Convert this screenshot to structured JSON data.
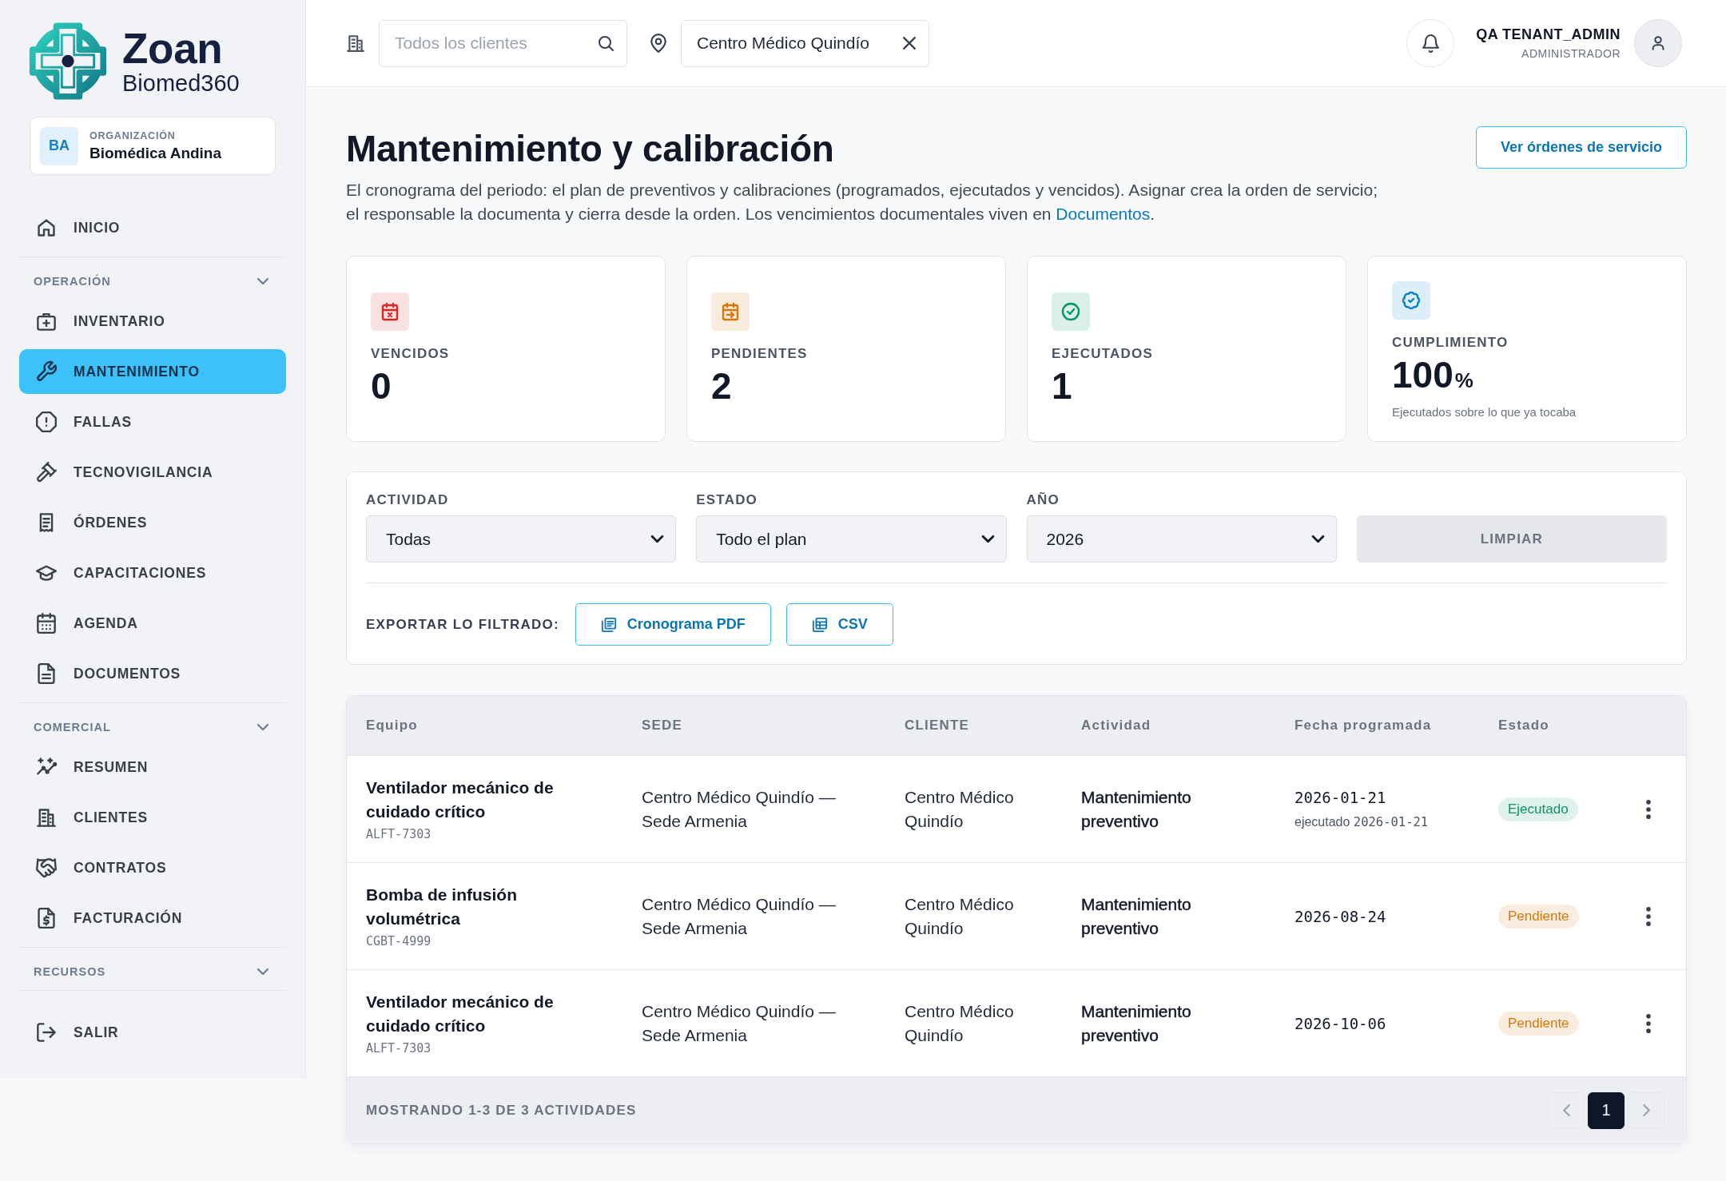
{
  "sidebar": {
    "brand": {
      "name": "Zoan",
      "product": "Biomed360"
    },
    "organization": {
      "initials": "BA",
      "label": "ORGANIZACIÓN",
      "name": "Biomédica Andina"
    },
    "nav_top": [
      {
        "label": "INICIO",
        "selected": false
      }
    ],
    "nav_groups": [
      {
        "title": "OPERACIÓN",
        "items": [
          {
            "label": "INVENTARIO",
            "selected": false
          },
          {
            "label": "MANTENIMIENTO",
            "selected": true
          },
          {
            "label": "FALLAS",
            "selected": false
          },
          {
            "label": "TECNOVIGILANCIA",
            "selected": false
          },
          {
            "label": "ÓRDENES",
            "selected": false
          },
          {
            "label": "CAPACITACIONES",
            "selected": false
          },
          {
            "label": "AGENDA",
            "selected": false
          },
          {
            "label": "DOCUMENTOS",
            "selected": false
          }
        ]
      },
      {
        "title": "COMERCIAL",
        "items": [
          {
            "label": "RESUMEN",
            "selected": false
          },
          {
            "label": "CLIENTES",
            "selected": false
          },
          {
            "label": "CONTRATOS",
            "selected": false
          },
          {
            "label": "FACTURACIÓN",
            "selected": false
          }
        ]
      },
      {
        "title": "RECURSOS"
      }
    ],
    "logout": {
      "label": "SALIR"
    }
  },
  "header": {
    "client_search": {
      "placeholder": "Todos los clientes"
    },
    "site_filter": {
      "value": "Centro Médico Quindío"
    },
    "user": {
      "name": "QA TENANT_ADMIN",
      "role": "ADMINISTRADOR"
    }
  },
  "page": {
    "title": "Mantenimiento y calibración",
    "description": {
      "text": "El cronograma del periodo: el plan de preventivos y calibraciones (programados, ejecutados y vencidos). Asignar crea la orden de servicio; el responsable la documenta y cierra desde la orden. Los vencimientos documentales viven en ",
      "link": "Documentos",
      "end": "."
    },
    "action": {
      "label": "Ver órdenes de servicio"
    }
  },
  "stats": [
    {
      "label": "VENCIDOS",
      "value": "0",
      "color": "#dc2626"
    },
    {
      "label": "PENDIENTES",
      "value": "2",
      "color": "#d97706"
    },
    {
      "label": "EJECUTADOS",
      "value": "1",
      "color": "#059669"
    },
    {
      "label": "CUMPLIMIENTO",
      "value": "100",
      "unit": "%",
      "note": "Ejecutados sobre lo que ya tocaba",
      "color": "#0284c7"
    }
  ],
  "filters": {
    "selects": [
      {
        "label": "ACTIVIDAD",
        "value": "Todas"
      },
      {
        "label": "ESTADO",
        "value": "Todo el plan"
      },
      {
        "label": "AÑO",
        "value": "2026"
      }
    ],
    "clear_button": {
      "label": "LIMPIAR",
      "disabled": true
    },
    "export": {
      "label": "EXPORTAR LO FILTRADO:",
      "buttons": [
        "Cronograma PDF",
        "CSV"
      ]
    }
  },
  "table": {
    "columns": [
      "Equipo",
      "SEDE",
      "CLIENTE",
      "Actividad",
      "Fecha programada",
      "Estado"
    ],
    "rows": [
      {
        "equipment": "Ventilador mecánico de cuidado crítico",
        "code": "ALFT-7303",
        "site": "Centro Médico Quindío — Sede Armenia",
        "client": "Centro Médico Quindío",
        "activity": "Mantenimiento preventivo",
        "scheduled": "2026-01-21",
        "executed": {
          "label": "ejecutado",
          "date": "2026-01-21"
        },
        "status": {
          "label": "Ejecutado",
          "color": "#059669"
        }
      },
      {
        "equipment": "Bomba de infusión volumétrica",
        "code": "CGBT-4999",
        "site": "Centro Médico Quindío — Sede Armenia",
        "client": "Centro Médico Quindío",
        "activity": "Mantenimiento preventivo",
        "scheduled": "2026-08-24",
        "status": {
          "label": "Pendiente",
          "color": "#d97706"
        }
      },
      {
        "equipment": "Ventilador mecánico de cuidado crítico",
        "code": "ALFT-7303",
        "site": "Centro Médico Quindío — Sede Armenia",
        "client": "Centro Médico Quindío",
        "activity": "Mantenimiento preventivo",
        "scheduled": "2026-10-06",
        "status": {
          "label": "Pendiente",
          "color": "#d97706"
        }
      }
    ],
    "footer": "MOSTRANDO 1-3 DE 3 ACTIVIDADES",
    "pages": [
      {
        "label": "1",
        "selected": true
      }
    ]
  }
}
